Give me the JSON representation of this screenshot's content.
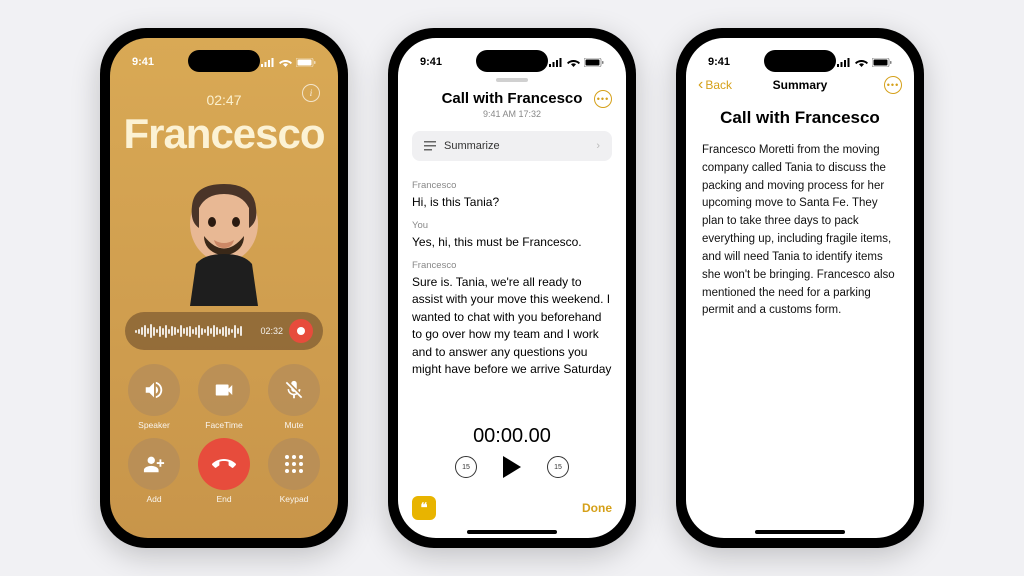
{
  "status": {
    "time": "9:41"
  },
  "call": {
    "duration": "02:47",
    "name": "Francesco",
    "waveform_time": "02:32",
    "buttons": {
      "speaker": "Speaker",
      "facetime": "FaceTime",
      "mute": "Mute",
      "add": "Add",
      "end": "End",
      "keypad": "Keypad"
    }
  },
  "transcript": {
    "title": "Call with Francesco",
    "subtitle": "9:41 AM  17:32",
    "summarize_label": "Summarize",
    "lines": [
      {
        "speaker": "Francesco",
        "text": "Hi, is this Tania?"
      },
      {
        "speaker": "You",
        "text": "Yes, hi, this must be Francesco."
      },
      {
        "speaker": "Francesco",
        "text": "Sure is. Tania, we're all ready to assist with your move this weekend. I wanted to chat with you beforehand to go over how my team and I work and to answer any questions you might have before we arrive Saturday"
      }
    ],
    "player_time": "00:00.00",
    "skip_back": "15",
    "skip_fwd": "15",
    "done_label": "Done"
  },
  "summary": {
    "back_label": "Back",
    "nav_title": "Summary",
    "title": "Call with Francesco",
    "body": "Francesco Moretti from the moving company called Tania to discuss the packing and moving process for her upcoming move to Santa Fe. They plan to take three days to pack everything up, including fragile items, and will need Tania to identify items she won't be bringing. Francesco also mentioned the need for a parking permit and a customs form."
  }
}
